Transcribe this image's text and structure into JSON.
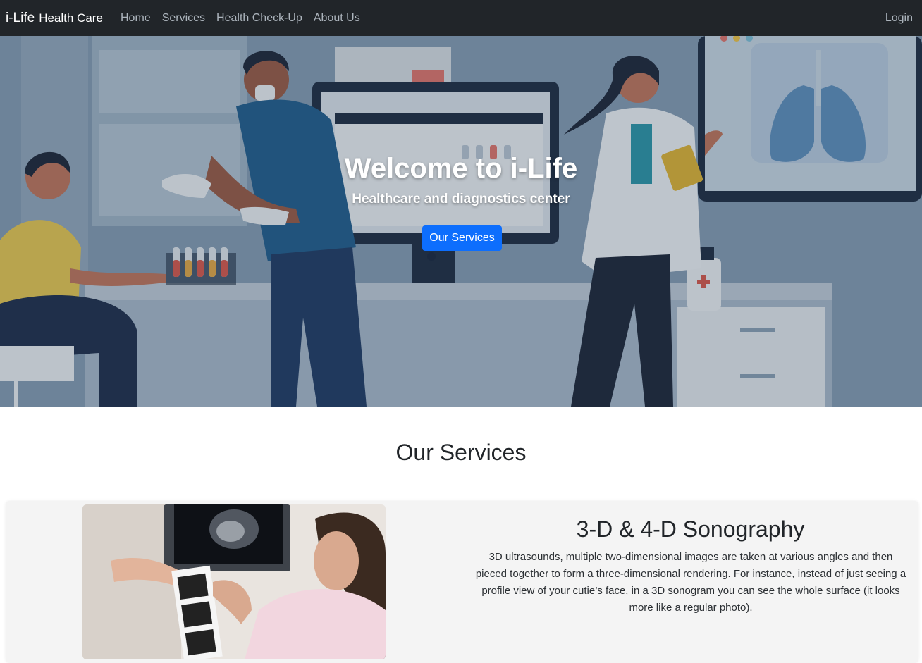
{
  "navbar": {
    "brand_strong": "i-Life",
    "brand_rest": "Health Care",
    "links": [
      "Home",
      "Services",
      "Health Check-Up",
      "About Us"
    ],
    "login": "Login"
  },
  "hero": {
    "title": "Welcome to i-Life",
    "subtitle": "Healthcare and diagnostics center",
    "button": "Our Services"
  },
  "services": {
    "heading": "Our Services",
    "items": [
      {
        "title": "3-D & 4-D Sonography",
        "description": "3D ultrasounds, multiple two-dimensional images are taken at various angles and then pieced together to form a three-dimensional rendering. For instance, instead of just seeing a profile view of your cutie’s face, in a 3D sonogram you can see the whole surface (it looks more like a regular photo)."
      }
    ]
  },
  "colors": {
    "navbar_bg": "#212529",
    "nav_link": "#adb5bd",
    "primary": "#0d6efd",
    "card_bg": "#f4f4f4"
  },
  "icons": {
    "hero_illustration": "medical-clinic-illustration",
    "service_image": "sonography-photo"
  }
}
